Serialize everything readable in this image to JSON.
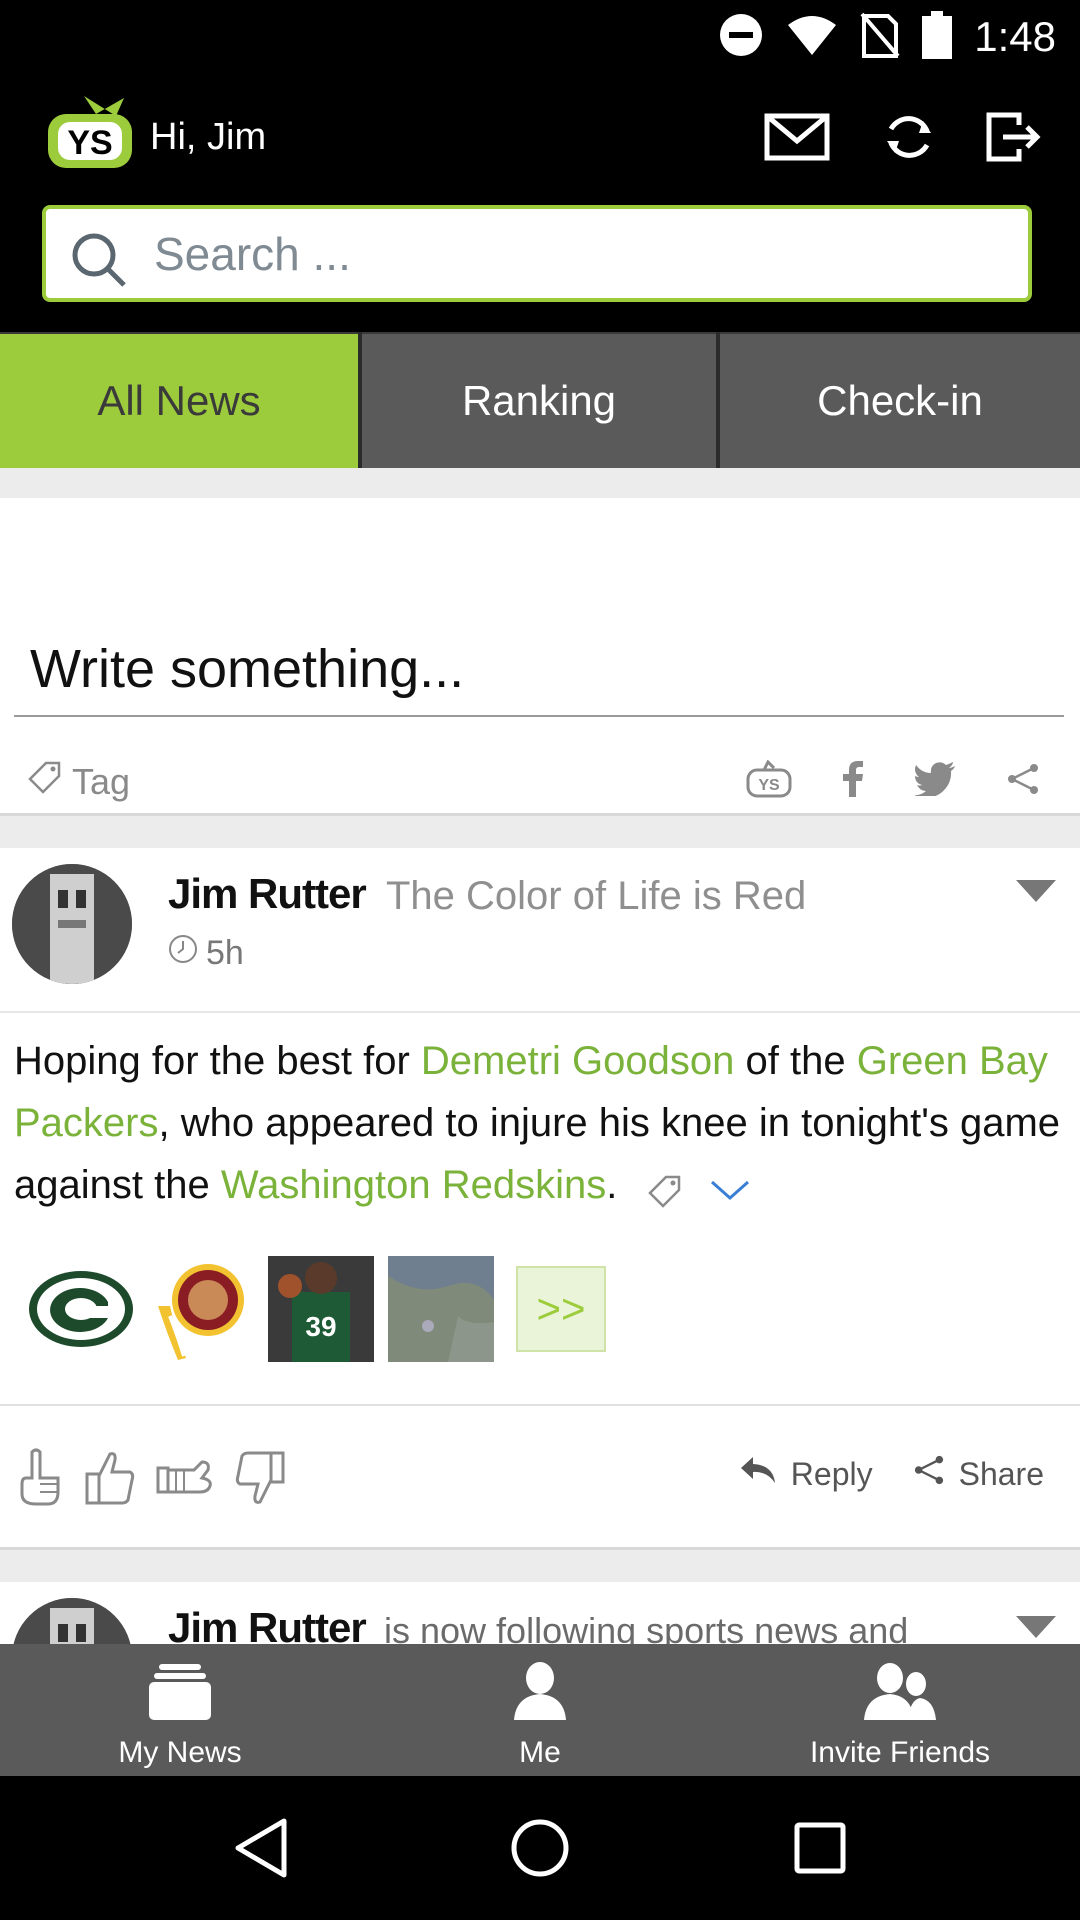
{
  "status_bar": {
    "time": "1:48",
    "icons": [
      "do-not-disturb-icon",
      "wifi-icon",
      "no-sim-icon",
      "battery-icon"
    ]
  },
  "header": {
    "greeting": "Hi, Jim",
    "logo_text": "YS",
    "icons": [
      "mail-icon",
      "refresh-icon",
      "logout-icon"
    ]
  },
  "search": {
    "placeholder": "Search ..."
  },
  "tabs": [
    {
      "label": "All News",
      "active": true
    },
    {
      "label": "Ranking",
      "active": false
    },
    {
      "label": "Check-in",
      "active": false
    }
  ],
  "composer": {
    "placeholder": "Write something...",
    "tag_label": "Tag",
    "share_icons": [
      "ys-share-icon",
      "facebook-icon",
      "twitter-icon",
      "share-icon"
    ]
  },
  "post": {
    "author": "Jim Rutter",
    "subtitle": "The Color of Life is Red",
    "time": "5h",
    "text_parts": [
      {
        "text": "Hoping for the best for ",
        "link": false
      },
      {
        "text": "Demetri Goodson",
        "link": true
      },
      {
        "text": " of the ",
        "link": false
      },
      {
        "text": "Green Bay Packers",
        "link": true
      },
      {
        "text": ", who appeared to injure his knee in tonight's game against the ",
        "link": false
      },
      {
        "text": "Washington Redskins",
        "link": true
      },
      {
        "text": ".",
        "link": false
      }
    ],
    "more_label": ">>",
    "actions": {
      "reply": "Reply",
      "share": "Share"
    }
  },
  "post2": {
    "author": "Jim Rutter",
    "subtitle": "is now following sports news and"
  },
  "bottom_nav": [
    {
      "label": "My News",
      "icon": "stack-icon"
    },
    {
      "label": "Me",
      "icon": "person-icon"
    },
    {
      "label": "Invite Friends",
      "icon": "friends-icon"
    }
  ],
  "colors": {
    "accent": "#9ccc3c",
    "link": "#7ab23a",
    "tab_inactive": "#5a5a5a"
  }
}
